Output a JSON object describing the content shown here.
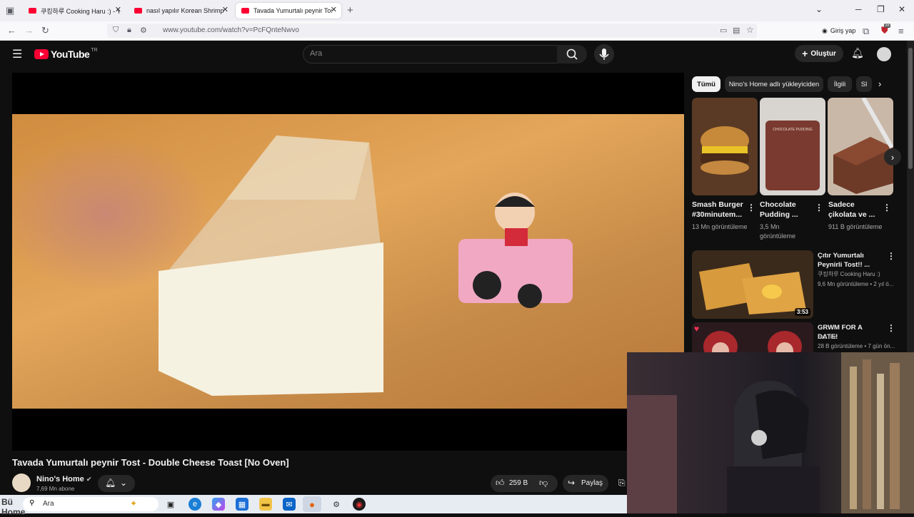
{
  "browser": {
    "tabs": [
      {
        "label": "쿠킹하루 Cooking Haru :) - You"
      },
      {
        "label": "nasıl yapılır Korean Shrimp"
      },
      {
        "label": "Tavada Yumurtalı peynir Tost - D"
      }
    ],
    "url": "www.youtube.com/watch?v=PcFQnteNwvo",
    "login_label": "Giriş yap",
    "ext_badge": "38"
  },
  "youtube": {
    "logo_text": "YouTube",
    "country_code": "TR",
    "search_placeholder": "Ara",
    "create_label": "Oluştur"
  },
  "video": {
    "title": "Tavada Yumurtalı peynir Tost - Double Cheese Toast [No Oven]",
    "channel": "Nino's Home",
    "subscribers": "7,69 Mn abone",
    "likes": "259 B",
    "share_label": "Paylaş"
  },
  "sidebar": {
    "chips": [
      "Tümü",
      "Nino's Home adlı yükleyiciden",
      "İlgili",
      "Sl"
    ],
    "shorts": [
      {
        "title": "Smash Burger #30minutem...",
        "views": "13 Mn görüntüleme",
        "thumb_color": "#6b4a2e"
      },
      {
        "title": "Chocolate Pudding ...",
        "views": "3,5 Mn görüntüleme",
        "thumb_color": "#7a3a30"
      },
      {
        "title": "Sadece çikolata ve ...",
        "views": "911 B görüntüleme",
        "thumb_color": "#6e3a28"
      }
    ],
    "short_thumb_text": "CHOCOLATE PUDDING",
    "videos": [
      {
        "title": "Çıtır Yumurtalı Peynirli Tost!! ...",
        "channel": "쿠킹하루 Cooking Haru :)",
        "meta": "9,6 Mn görüntüleme • 2 yıl ö...",
        "duration": "3:53"
      },
      {
        "title": "GRWM FOR A DATE!",
        "channel": "eve frsr",
        "meta": "28 B görüntüleme • 7 gün ön..."
      }
    ]
  },
  "taskbar": {
    "search_placeholder": "Ara",
    "overlay_text": "Bü Home"
  },
  "colors": {
    "yt_red": "#ff0033",
    "background": "#0f0f0f"
  }
}
